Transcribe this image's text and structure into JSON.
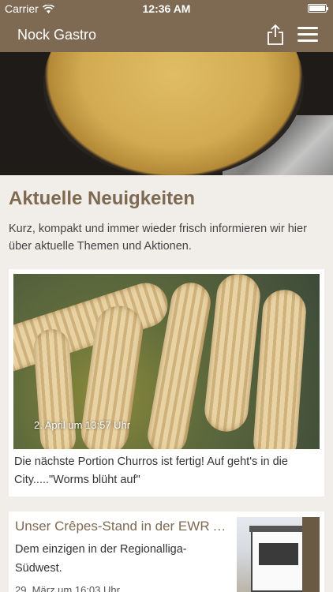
{
  "status_bar": {
    "carrier": "Carrier",
    "time": "12:36 AM"
  },
  "navbar": {
    "title": "Nock Gastro",
    "share_icon": "share-icon",
    "menu_icon": "hamburger-menu-icon"
  },
  "section": {
    "title": "Aktuelle Neuigkeiten",
    "intro": "Kurz, kompakt und immer wieder frisch informieren wir hier über aktuelle Themen und Aktionen."
  },
  "posts": [
    {
      "date": "2. April um 13:57 Uhr",
      "text": "Die nächste Portion Churros ist fertig! Auf geht's in die City.....\"Worms blüht auf\""
    },
    {
      "title": "Unser Crêpes-Stand in der EWR A...",
      "text": "Dem einzigen in der Regionalliga-Südwest.",
      "date": "29. März um 16:03 Uhr"
    }
  ],
  "colors": {
    "brand": "#7e6a53",
    "background": "#f1ede8"
  }
}
